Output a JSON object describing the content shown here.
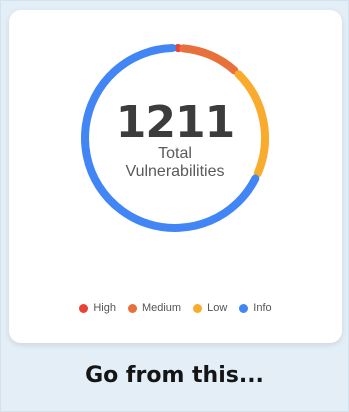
{
  "summary": {
    "total": "1211",
    "label_line1": "Total",
    "label_line2": "Vulnerabilities"
  },
  "legend": [
    {
      "label": "High",
      "color": "#e94335"
    },
    {
      "label": "Medium",
      "color": "#e8703a"
    },
    {
      "label": "Low",
      "color": "#f9ab2e"
    },
    {
      "label": "Info",
      "color": "#4285f4"
    }
  ],
  "caption": "Go from this...",
  "chart_data": {
    "type": "pie",
    "categories": [
      "High",
      "Medium",
      "Low",
      "Info"
    ],
    "values": [
      12,
      133,
      242,
      824
    ]
  }
}
